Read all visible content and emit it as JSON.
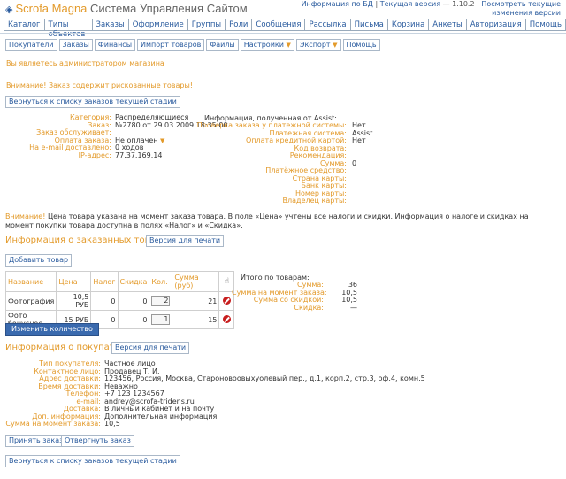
{
  "header": {
    "brand": "Scrofa Magna",
    "subtitle": "Система Управления Сайтом",
    "db_info_link": "Информация по БД",
    "version_label": "Текущая версия",
    "version": "— 1.10.2",
    "changes_link": "Посмотреть текущие изменения версии"
  },
  "main_menu": [
    "Каталог",
    "Типы объектов",
    "Заказы",
    "Оформление",
    "Группы",
    "Роли",
    "Сообщения",
    "Рассылка",
    "Письма",
    "Корзина",
    "Анкеты",
    "Авторизация",
    "Помощь"
  ],
  "sub_menu": {
    "buyers": "Покупатели",
    "orders": "Заказы",
    "finance": "Финансы",
    "import": "Импорт товаров",
    "files": "Файлы",
    "settings": "Настройки",
    "export": "Экспорт",
    "help": "Помощь"
  },
  "admin_notice": "Вы являетесь администратором магазина",
  "risk_notice": "Внимание! Заказ содержит рискованные товары!",
  "back_button": "Вернуться к списку заказов текущей стадии",
  "order": [
    {
      "k": "Категория:",
      "v": "Распределяющиеся"
    },
    {
      "k": "Заказ:",
      "v": "№2780 от 29.03.2009 18:35:00"
    },
    {
      "k": "Заказ обслуживает:",
      "v": ""
    },
    {
      "k": "Оплата заказа:",
      "v": "Не оплачен"
    },
    {
      "k": "На e-mail доставлено:",
      "v": "0 ходов"
    },
    {
      "k": "IP-адрес:",
      "v": "77.37.169.14"
    }
  ],
  "assist": {
    "title": "Информация, полученная от Assist:",
    "rows": [
      {
        "k": "Проверка заказа у платежной системы:",
        "v": "Нет"
      },
      {
        "k": "Платежная система:",
        "v": "Assist"
      },
      {
        "k": "Оплата кредитной картой:",
        "v": "Нет"
      },
      {
        "k": "Код возврата:",
        "v": ""
      },
      {
        "k": "Рекомендация:",
        "v": ""
      },
      {
        "k": "Сумма:",
        "v": "0"
      },
      {
        "k": "Платёжное средство:",
        "v": ""
      },
      {
        "k": "Страна карты:",
        "v": ""
      },
      {
        "k": "Банк карты:",
        "v": ""
      },
      {
        "k": "Номер карты:",
        "v": ""
      },
      {
        "k": "Владелец карты:",
        "v": ""
      }
    ]
  },
  "price_notice": {
    "lead": "Внимание!",
    "text": " Цена товара указана на момент заказа товара. В поле «Цена» учтены все налоги и скидки. Информация о налоге и скидках на момент покупки товара доступна в полях «Налог» и «Скидка»."
  },
  "ordered_items": {
    "title": "Информация о заказанных товарах",
    "print_button": "Версия для печати",
    "add_button": "Добавить товар",
    "columns": [
      "Название",
      "Цена",
      "Налог",
      "Скидка",
      "Кол.",
      "Сумма (руб)"
    ],
    "rows": [
      {
        "name": "Фотография",
        "price": "10,5 РУБ",
        "tax": "0",
        "discount": "0",
        "qty": "2",
        "sum": "21"
      },
      {
        "name": "Фото бонусное",
        "price": "15 РУБ",
        "tax": "0",
        "discount": "0",
        "qty": "1",
        "sum": "15"
      }
    ],
    "change_qty_button": "Изменить количество"
  },
  "totals": {
    "title": "Итого по товарам:",
    "rows": [
      {
        "k": "Сумма:",
        "v": "36"
      },
      {
        "k": "Сумма на момент заказа:",
        "v": "10,5"
      },
      {
        "k": "Сумма со скидкой:",
        "v": "10,5"
      },
      {
        "k": "Скидка:",
        "v": "—"
      }
    ]
  },
  "buyer": {
    "title": "Информация о покупателе",
    "print_button": "Версия для печати",
    "rows": [
      {
        "k": "Тип покупателя:",
        "v": "Частное лицо"
      },
      {
        "k": "Контактное лицо:",
        "v": "Продавец Т. И."
      },
      {
        "k": "Адрес доставки:",
        "v": "123456, Россия, Москва, Староновоовыхуолевый пер., д.1, корп.2, стр.3, оф.4, комн.5"
      },
      {
        "k": "Время доставки:",
        "v": "Неважно"
      },
      {
        "k": "Телефон:",
        "v": "+7 123 1234567"
      },
      {
        "k": "e-mail:",
        "v": "andrey@scrofa-tridens.ru"
      },
      {
        "k": "Доставка:",
        "v": "В личный кабинет и на почту"
      },
      {
        "k": "Доп. информация:",
        "v": "Дополнительная информация"
      },
      {
        "k": "Сумма на момент заказа:",
        "v": "10,5"
      }
    ]
  },
  "actions": {
    "accept": "Принять заказ",
    "reject": "Отвергнуть заказ"
  },
  "back_button_bottom": "Вернуться к списку заказов текущей стадии"
}
